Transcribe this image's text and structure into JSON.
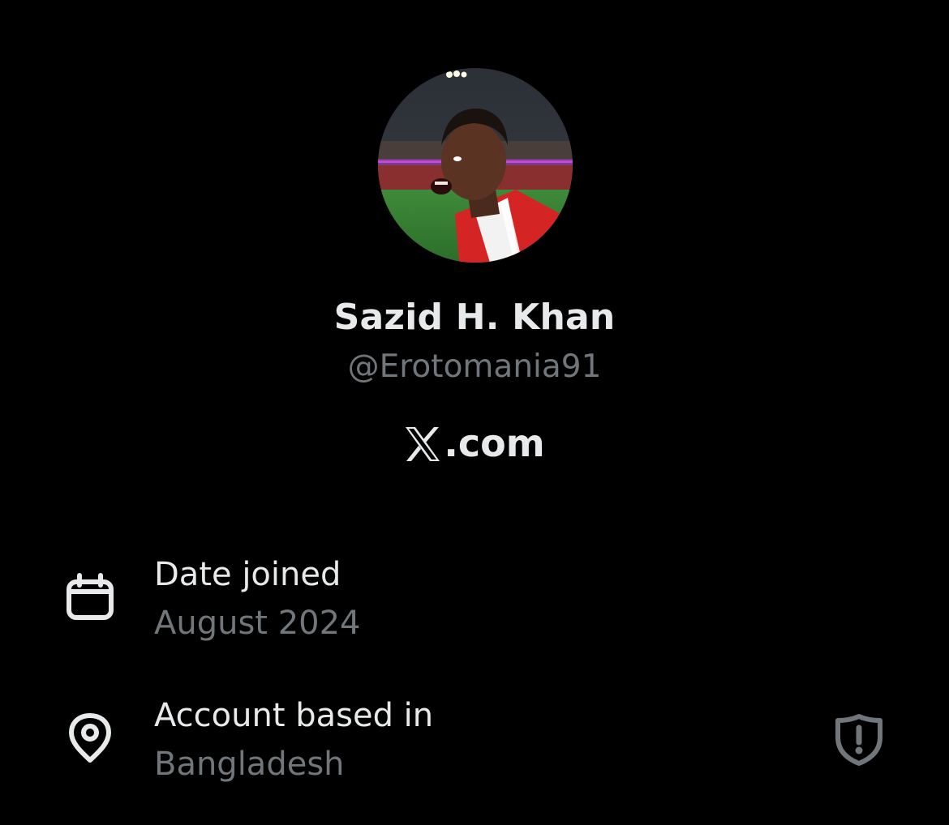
{
  "profile": {
    "display_name": "Sazid H. Khan",
    "handle": "@Erotomania91",
    "avatar_icon": "profile-photo"
  },
  "brand": {
    "text": ".com",
    "logo_icon": "x-logo-icon"
  },
  "details": {
    "date_joined": {
      "label": "Date joined",
      "value": "August 2024",
      "icon": "calendar-icon"
    },
    "account_based_in": {
      "label": "Account based in",
      "value": "Bangladesh",
      "icon": "location-pin-icon",
      "badge_icon": "shield-alert-icon"
    }
  },
  "colors": {
    "background": "#000000",
    "primary_text": "#e7e9ea",
    "secondary_text": "#71767b"
  }
}
